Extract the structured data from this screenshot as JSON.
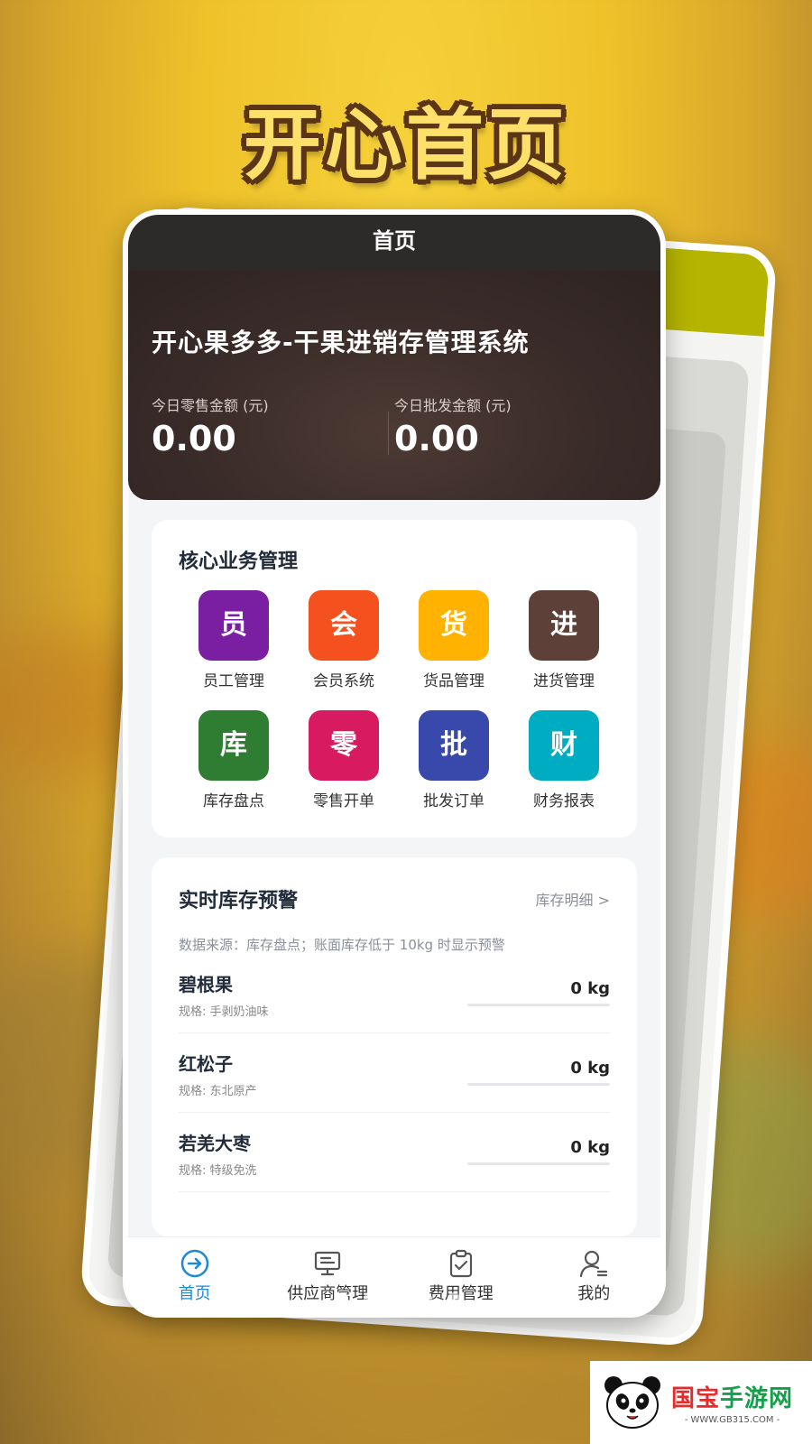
{
  "promo": {
    "title": "开心首页"
  },
  "topbar": {
    "title": "首页"
  },
  "hero": {
    "app_name": "开心果多多-干果进销存管理系统",
    "stats": [
      {
        "label": "今日零售金额 (元)",
        "value": "0.00"
      },
      {
        "label": "今日批发金额 (元)",
        "value": "0.00"
      }
    ]
  },
  "core": {
    "title": "核心业务管理",
    "tiles": [
      {
        "glyph": "员",
        "label": "员工管理",
        "color": "#7b1fa2"
      },
      {
        "glyph": "会",
        "label": "会员系统",
        "color": "#f4511e"
      },
      {
        "glyph": "货",
        "label": "货品管理",
        "color": "#ffb300"
      },
      {
        "glyph": "进",
        "label": "进货管理",
        "color": "#5d4037"
      },
      {
        "glyph": "库",
        "label": "库存盘点",
        "color": "#2e7d32"
      },
      {
        "glyph": "零",
        "label": "零售开单",
        "color": "#d81b60"
      },
      {
        "glyph": "批",
        "label": "批发订单",
        "color": "#3949ab"
      },
      {
        "glyph": "财",
        "label": "财务报表",
        "color": "#00acc1"
      }
    ]
  },
  "stock": {
    "title": "实时库存预警",
    "link": "库存明细 >",
    "note": "数据来源：库存盘点；账面库存低于 10kg 时显示预警",
    "items": [
      {
        "name": "碧根果",
        "spec": "规格: 手剥奶油味",
        "qty": "0 kg"
      },
      {
        "name": "红松子",
        "spec": "规格: 东北原产",
        "qty": "0 kg"
      },
      {
        "name": "若羌大枣",
        "spec": "规格: 特级免洗",
        "qty": "0 kg"
      }
    ]
  },
  "tabbar": [
    {
      "label": "首页",
      "icon": "arrow-circle-icon"
    },
    {
      "label": "供应商管理",
      "icon": "monitor-icon"
    },
    {
      "label": "费用管理",
      "icon": "clipboard-check-icon"
    },
    {
      "label": "我的",
      "icon": "user-icon"
    }
  ],
  "carousel": {
    "count": 5,
    "active": 1
  },
  "watermark": {
    "brand_a": "国宝",
    "brand_b": "手游网",
    "url": "- WWW.GB315.COM -"
  }
}
